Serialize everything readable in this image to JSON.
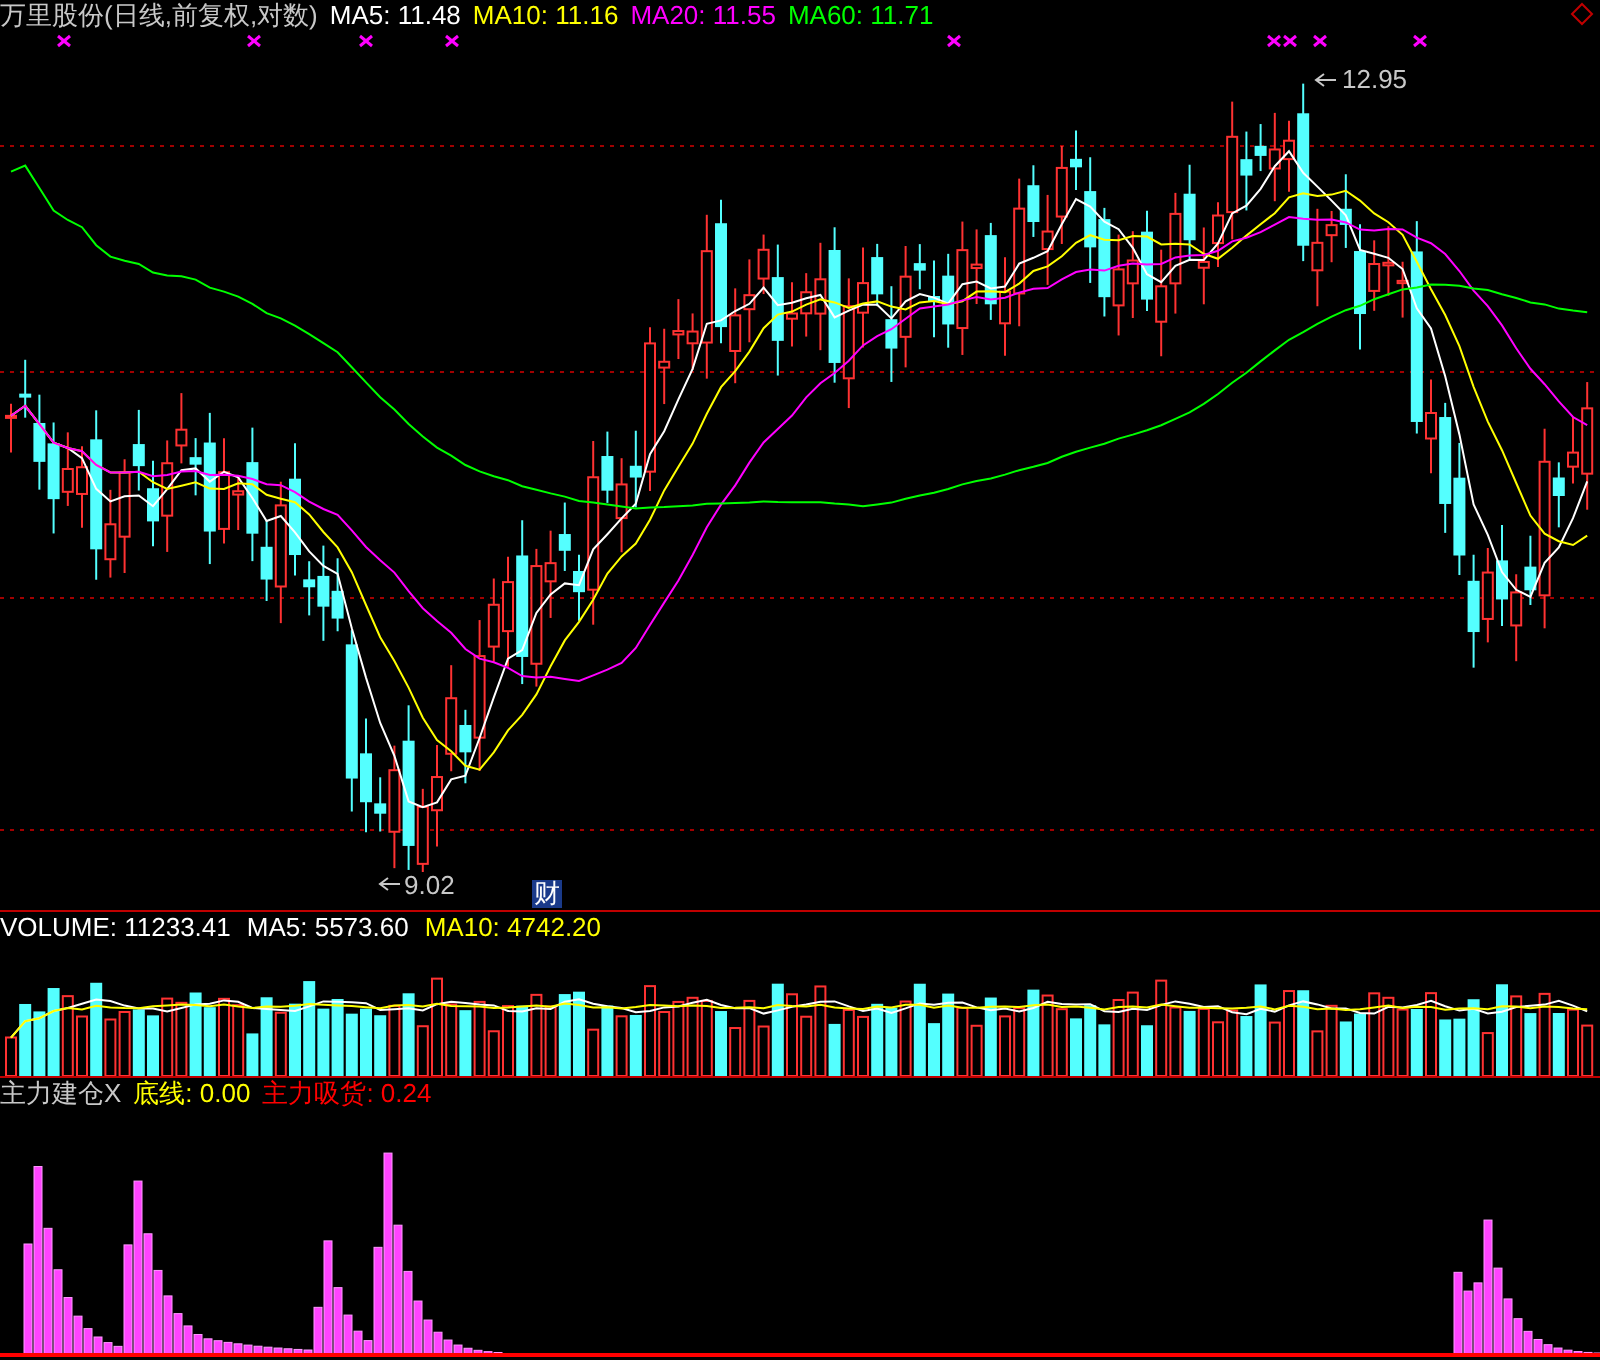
{
  "main_chart": {
    "title": "万里股份(日线,前复权,对数)",
    "indicators": [
      {
        "label": "MA5: 11.48",
        "color": "#ffffff"
      },
      {
        "label": "MA10: 11.16",
        "color": "#ffff00"
      },
      {
        "label": "MA20: 11.55",
        "color": "#ff00ff"
      },
      {
        "label": "MA60: 11.71",
        "color": "#00ff00"
      }
    ],
    "high_label": "12.95",
    "low_label": "9.02",
    "event_marker": "财"
  },
  "volume_panel": {
    "indicators": [
      {
        "label": "VOLUME: 11233.41",
        "color": "#ffffff"
      },
      {
        "label": "MA5: 5573.60",
        "color": "#ffffff"
      },
      {
        "label": "MA10: 4742.20",
        "color": "#ffff00"
      }
    ]
  },
  "indicator_panel": {
    "title": "主力建仓X",
    "indicators": [
      {
        "label": "底线: 0.00",
        "color": "#ffff00"
      },
      {
        "label": "主力吸货: 0.24",
        "color": "#ff0000"
      }
    ]
  }
}
